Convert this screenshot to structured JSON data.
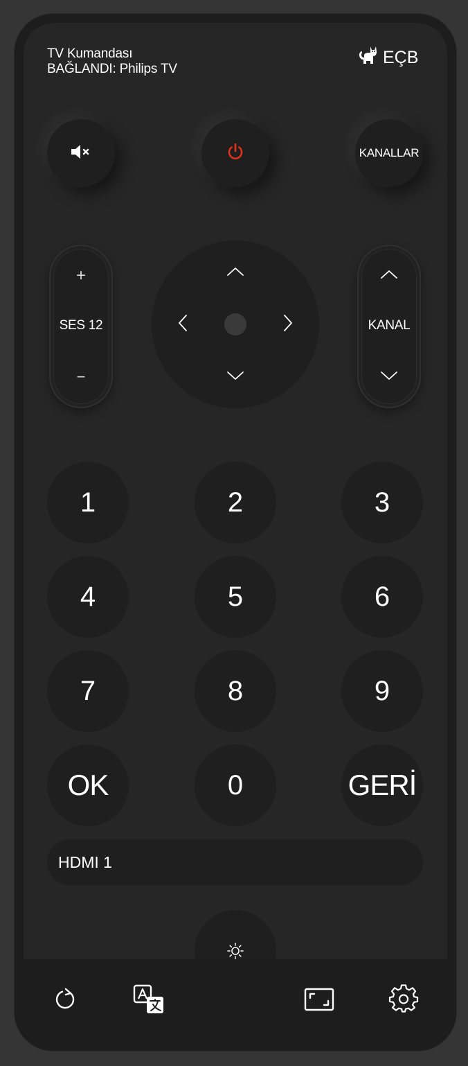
{
  "header": {
    "title": "TV Kumandası",
    "status": "BAĞLANDI: Philips TV",
    "brand": "EÇB"
  },
  "top_row": {
    "mute_icon": "speaker-muted-icon",
    "power_icon": "power-icon",
    "power_color": "#e0301e",
    "channels_label": "KANALLAR"
  },
  "volume": {
    "label": "SES 12",
    "up_symbol": "+",
    "down_symbol": "−"
  },
  "channel": {
    "label": "KANAL"
  },
  "dpad": {
    "up_icon": "chevron-up-icon",
    "down_icon": "chevron-down-icon",
    "left_icon": "chevron-left-icon",
    "right_icon": "chevron-right-icon"
  },
  "keypad": [
    [
      "1",
      "2",
      "3"
    ],
    [
      "4",
      "5",
      "6"
    ],
    [
      "7",
      "8",
      "9"
    ],
    [
      "OK",
      "0",
      "GERİ"
    ]
  ],
  "source": {
    "label": "HDMI 1"
  },
  "bottom_bar": {
    "icons": [
      "refresh-icon",
      "translate-icon",
      "aspect-ratio-icon",
      "settings-icon"
    ]
  },
  "colors": {
    "background": "#353535",
    "remote_body": "#1d1d1d",
    "panel": "#262626",
    "button": "#1f1f1f",
    "accent_power": "#e0301e"
  }
}
